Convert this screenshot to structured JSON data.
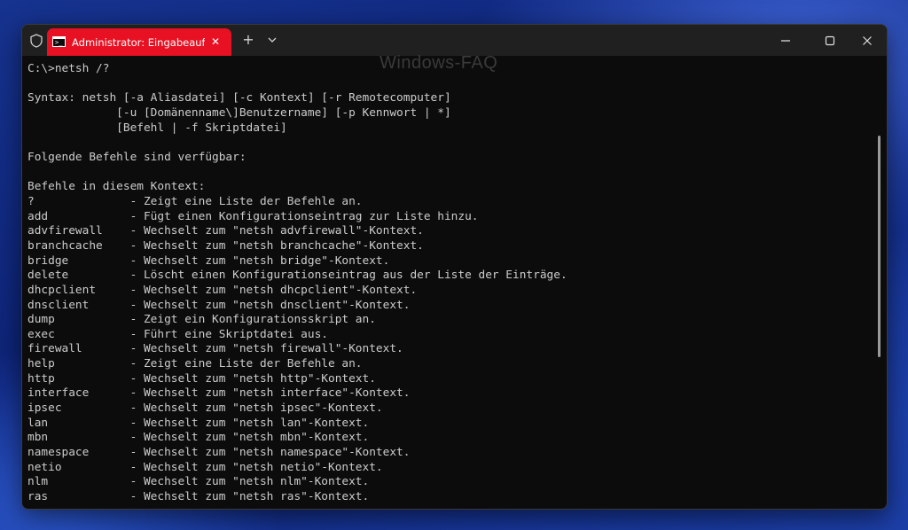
{
  "window": {
    "tab_title": "Administrator: Eingabeauffor",
    "tab_close": "✕",
    "new_tab": "+",
    "dropdown": "⌵",
    "watermark": "Windows-FAQ"
  },
  "terminal": {
    "lines": [
      "C:\\>netsh /?",
      "",
      "Syntax: netsh [-a Aliasdatei] [-c Kontext] [-r Remotecomputer]",
      "             [-u [Domänenname\\]Benutzername] [-p Kennwort | *]",
      "             [Befehl | -f Skriptdatei]",
      "",
      "Folgende Befehle sind verfügbar:",
      "",
      "Befehle in diesem Kontext:",
      "?              - Zeigt eine Liste der Befehle an.",
      "add            - Fügt einen Konfigurationseintrag zur Liste hinzu.",
      "advfirewall    - Wechselt zum \"netsh advfirewall\"-Kontext.",
      "branchcache    - Wechselt zum \"netsh branchcache\"-Kontext.",
      "bridge         - Wechselt zum \"netsh bridge\"-Kontext.",
      "delete         - Löscht einen Konfigurationseintrag aus der Liste der Einträge.",
      "dhcpclient     - Wechselt zum \"netsh dhcpclient\"-Kontext.",
      "dnsclient      - Wechselt zum \"netsh dnsclient\"-Kontext.",
      "dump           - Zeigt ein Konfigurationsskript an.",
      "exec           - Führt eine Skriptdatei aus.",
      "firewall       - Wechselt zum \"netsh firewall\"-Kontext.",
      "help           - Zeigt eine Liste der Befehle an.",
      "http           - Wechselt zum \"netsh http\"-Kontext.",
      "interface      - Wechselt zum \"netsh interface\"-Kontext.",
      "ipsec          - Wechselt zum \"netsh ipsec\"-Kontext.",
      "lan            - Wechselt zum \"netsh lan\"-Kontext.",
      "mbn            - Wechselt zum \"netsh mbn\"-Kontext.",
      "namespace      - Wechselt zum \"netsh namespace\"-Kontext.",
      "netio          - Wechselt zum \"netsh netio\"-Kontext.",
      "nlm            - Wechselt zum \"netsh nlm\"-Kontext.",
      "ras            - Wechselt zum \"netsh ras\"-Kontext."
    ]
  },
  "colors": {
    "tab_accent": "#e81123",
    "terminal_bg": "#0c0c0c",
    "terminal_text": "#cccccc",
    "titlebar_bg": "#202020"
  },
  "icons": {
    "shield": "shield-icon",
    "console": "console-icon",
    "close": "close-icon",
    "new_tab": "plus-icon",
    "dropdown": "chevron-down-icon",
    "minimize": "minimize-icon",
    "maximize": "maximize-icon",
    "close_window": "close-window-icon"
  }
}
